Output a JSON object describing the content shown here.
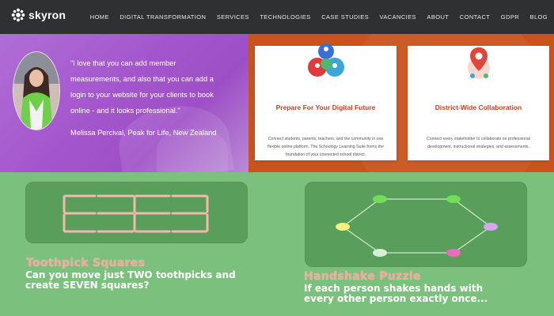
{
  "brand": {
    "name": "skyron"
  },
  "nav": {
    "items": [
      "HOME",
      "DIGITAL TRANSFORMATION",
      "SERVICES",
      "TECHNOLOGIES",
      "CASE STUDIES",
      "VACANCIES",
      "ABOUT",
      "CONTACT",
      "GDPR",
      "BLOG"
    ]
  },
  "testimonial": {
    "quote": "\"I love that you can add member measurements, and also that you can add a login to your website for your clients to book online - and it looks professional.\"",
    "author": "Melissa Percival, Peak for Life, New Zealand"
  },
  "cards": [
    {
      "title": "Prepare For Your Digital Future",
      "body": "Connect students, parents, teachers, and the community in one flexible online platform. The Schoology Learning Suite forms the foundation of your connected school district.",
      "icon": "people-network-icon"
    },
    {
      "title": "District-Wide Collaboration",
      "body": "Connect every stakeholder to collaborate on professional development, instructional strategies, and assessments.",
      "icon": "map-pin-icon"
    }
  ],
  "puzzles": [
    {
      "title": "Toothpick Squares",
      "description": "Can you move just TWO toothpicks and create SEVEN squares?"
    },
    {
      "title": "Handshake Puzzle",
      "description": "If each person shakes hands with every other person exactly once..."
    }
  ],
  "colors": {
    "nav_bg": "#2f3032",
    "testimonial_bg": "#a356cc",
    "card_section_bg": "#c9531c",
    "card_title": "#c0431d",
    "puzzle_bg": "#7cc07e",
    "puzzle_board": "#5a9e5c",
    "puzzle_title": "#f3a99c"
  }
}
